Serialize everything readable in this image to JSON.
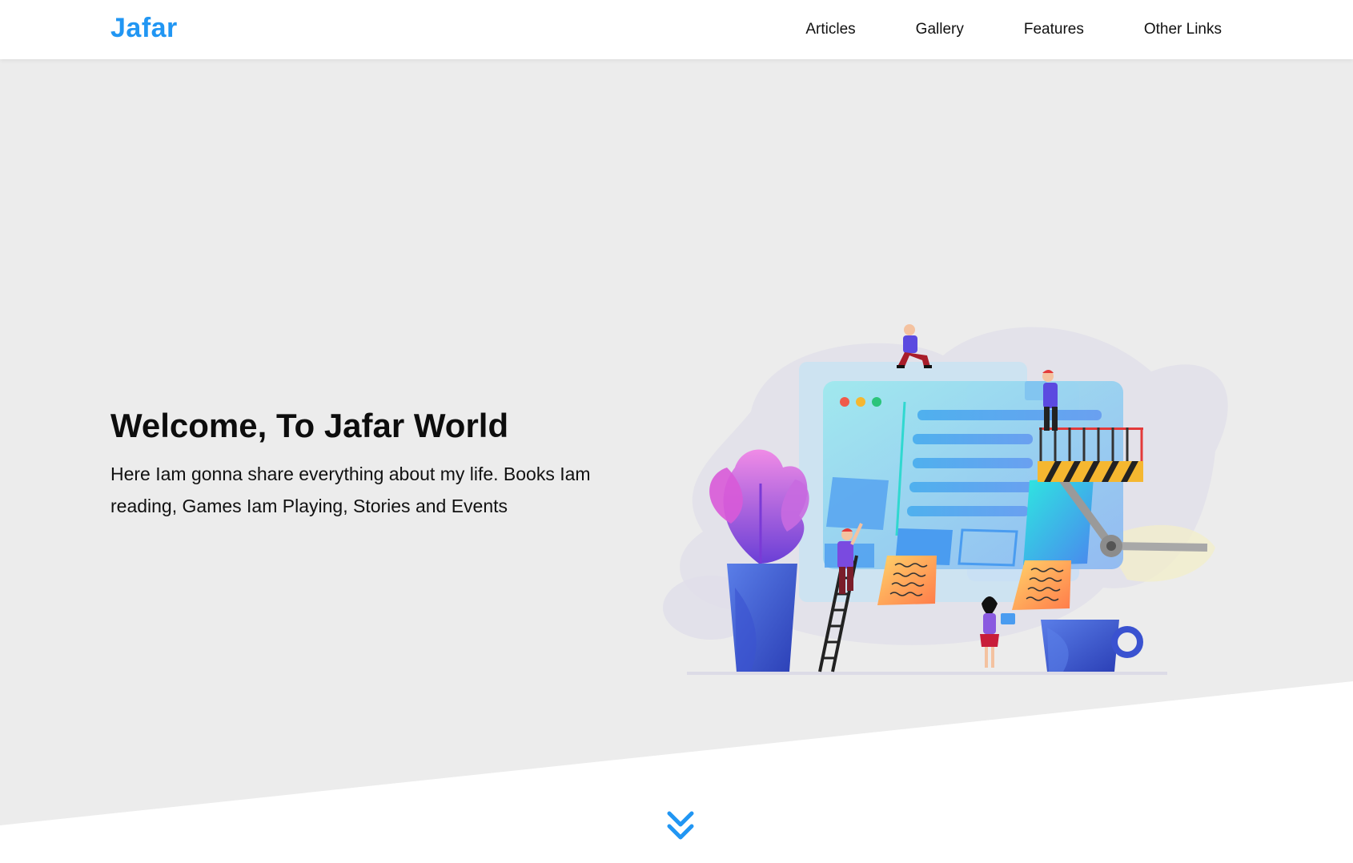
{
  "header": {
    "logo": "Jafar",
    "nav": [
      {
        "label": "Articles"
      },
      {
        "label": "Gallery"
      },
      {
        "label": "Features"
      },
      {
        "label": "Other Links"
      }
    ]
  },
  "hero": {
    "title": "Welcome, To Jafar World",
    "text": "Here Iam gonna share everything about my life. Books Iam reading, Games Iam Playing, Stories and Events"
  },
  "icons": {
    "scroll_down": "double-chevron-down-icon",
    "illustration": "website-builders-illustration"
  },
  "colors": {
    "brand": "#2196f3",
    "hero_bg": "#ececec",
    "header_bg": "#ffffff"
  }
}
